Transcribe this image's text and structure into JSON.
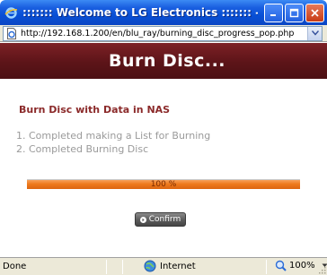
{
  "window": {
    "title": "::::::: Welcome to LG Electronics ::::::: - Window..."
  },
  "address_bar": {
    "url": "http://192.168.1.200/en/blu_ray/burning_disc_progress_pop.php"
  },
  "page": {
    "header": "Burn Disc...",
    "section_title": "Burn Disc with Data in NAS",
    "steps": [
      "1. Completed making a List for Burning",
      "2. Completed Burning Disc"
    ],
    "progress": {
      "value": 100,
      "label": "100 %"
    },
    "confirm_label": "Confirm",
    "header_color": "#5c1418",
    "accent_color": "#ee7a1c"
  },
  "status_bar": {
    "status": "Done",
    "zone": "Internet",
    "zoom": "100%"
  },
  "icons": {
    "title": "ie-icon",
    "page": "page-icon",
    "zone": "globe-icon",
    "zoom": "magnifier-icon"
  }
}
